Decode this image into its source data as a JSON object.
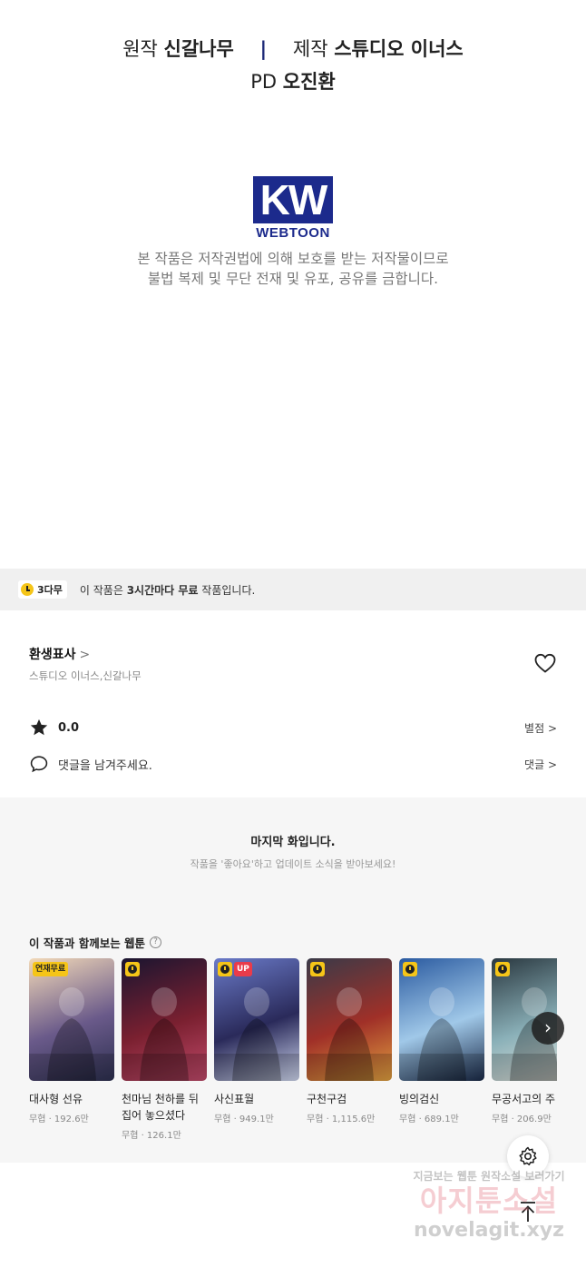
{
  "credits": {
    "original_label": "원작",
    "original_name": "신갈나무",
    "separator": "|",
    "production_label": "제작",
    "production_name": "스튜디오 이너스",
    "pd_label": "PD",
    "pd_name": "오진환"
  },
  "logo": {
    "letters": "KW",
    "sub": "WEBTOON"
  },
  "copyright": {
    "line1": "본 작품은 저작권법에 의해 보호를 받는 저작물이므로",
    "line2": "불법 복제 및 무단 전재 및 유포, 공유를 금합니다."
  },
  "notice": {
    "badge": "3다무",
    "prefix": "이 작품은 ",
    "bold": "3시간마다 무료",
    "suffix": " 작품입니다."
  },
  "work": {
    "title": "환생표사",
    "title_chevron": ">",
    "authors": "스튜디오 이너스,신갈나무",
    "rating": "0.0",
    "rating_link": "별점 >",
    "comment_placeholder": "댓글을 남겨주세요.",
    "comment_link": "댓글 >"
  },
  "last_episode": {
    "title": "마지막 화입니다.",
    "subtitle": "작품을 '좋아요'하고 업데이트 소식을 받아보세요!"
  },
  "recommendations": {
    "title": "이 작품과 함께보는 웹툰",
    "help": "?",
    "items": [
      {
        "title": "대사형 선유",
        "title2": "",
        "meta": "무협 · 192.6만",
        "tag": "연재무료",
        "colors": [
          "#f2d9b8",
          "#6a5a8a",
          "#2d3050"
        ]
      },
      {
        "title": "천마님 천하를 뒤",
        "title2": "집어 놓으셨다",
        "meta": "무협 · 126.1만",
        "tag": "clock",
        "colors": [
          "#1a1530",
          "#7a2030",
          "#c04a6a"
        ]
      },
      {
        "title": "사신표월",
        "title2": "",
        "meta": "무협 · 949.1만",
        "tag": "clock-up",
        "up": "UP",
        "colors": [
          "#6a7ac8",
          "#2a2a5a",
          "#d0d8f0"
        ]
      },
      {
        "title": "구천구검",
        "title2": "",
        "meta": "무협 · 1,115.6만",
        "tag": "clock",
        "colors": [
          "#3a3a48",
          "#a03028",
          "#e0a040"
        ]
      },
      {
        "title": "빙의검신",
        "title2": "",
        "meta": "무협 · 689.1만",
        "tag": "clock",
        "colors": [
          "#2a5aa0",
          "#a0c8e8",
          "#1a2a48"
        ]
      },
      {
        "title": "무공서고의 주",
        "title2": "",
        "meta": "무협 · 206.9만",
        "tag": "clock",
        "colors": [
          "#2a3840",
          "#8ab0b8",
          "#e8e8e0"
        ]
      }
    ],
    "next": "›"
  },
  "watermark": {
    "line1": "지금보는 웹툰 원작소설 보러가기",
    "line2": "아지툰소설",
    "line3": "novelagit.xyz"
  },
  "icons": {
    "heart": "heart-icon",
    "star": "star-icon",
    "comment": "speech-bubble-icon",
    "settings": "gear-icon",
    "scroll_top": "arrow-up-icon"
  },
  "colors": {
    "brand_blue": "#1c2a8c",
    "accent_yellow": "#f5c518",
    "up_red": "#e93b4a"
  }
}
